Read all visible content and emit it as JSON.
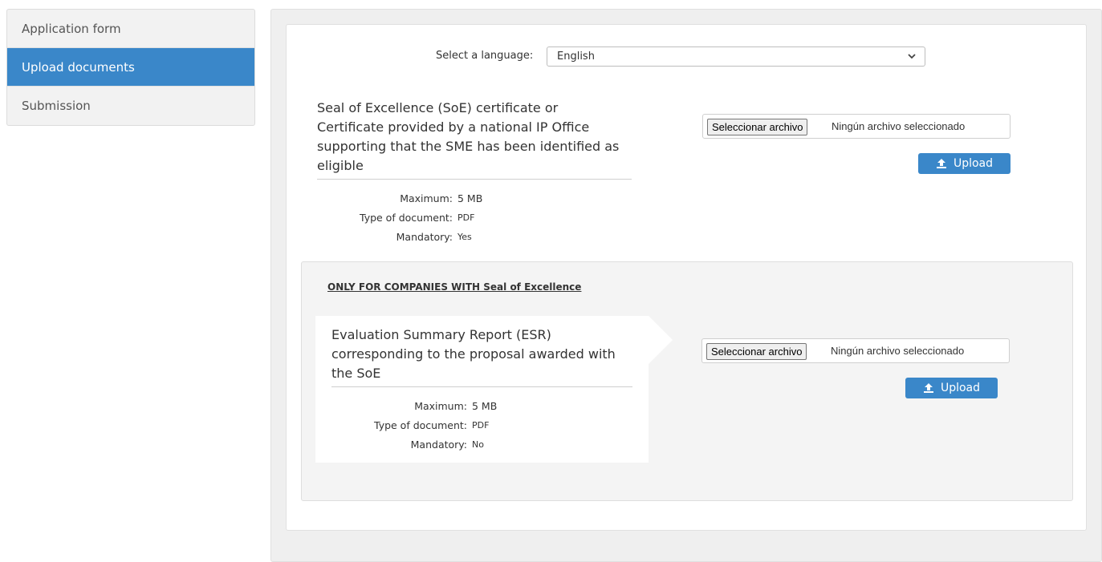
{
  "sidebar": {
    "items": [
      {
        "label": "Application form",
        "active": false
      },
      {
        "label": "Upload documents",
        "active": true
      },
      {
        "label": "Submission",
        "active": false
      }
    ]
  },
  "language": {
    "label": "Select a language:",
    "selected": "English"
  },
  "documents": [
    {
      "title": "Seal of Excellence (SoE) certificate or Certificate provided by a national IP Office supporting that the SME has been identified as eligible",
      "max_label": "Maximum:",
      "max_value": "5 MB",
      "type_label": "Type of document:",
      "type_value": "PDF",
      "mandatory_label": "Mandatory:",
      "mandatory_value": "Yes",
      "file_button": "Seleccionar archivo",
      "file_status": "Ningún archivo seleccionado",
      "upload_label": "Upload"
    },
    {
      "title": "Evaluation Summary Report (ESR) corresponding to the proposal awarded with the SoE",
      "max_label": "Maximum:",
      "max_value": "5 MB",
      "type_label": "Type of document:",
      "type_value": "PDF",
      "mandatory_label": "Mandatory:",
      "mandatory_value": "No",
      "file_button": "Seleccionar archivo",
      "file_status": "Ningún archivo seleccionado",
      "upload_label": "Upload"
    }
  ],
  "seal_section": {
    "heading": "ONLY FOR COMPANIES WITH Seal of Excellence"
  },
  "colors": {
    "accent": "#3a87c9",
    "panel": "#efefef"
  }
}
